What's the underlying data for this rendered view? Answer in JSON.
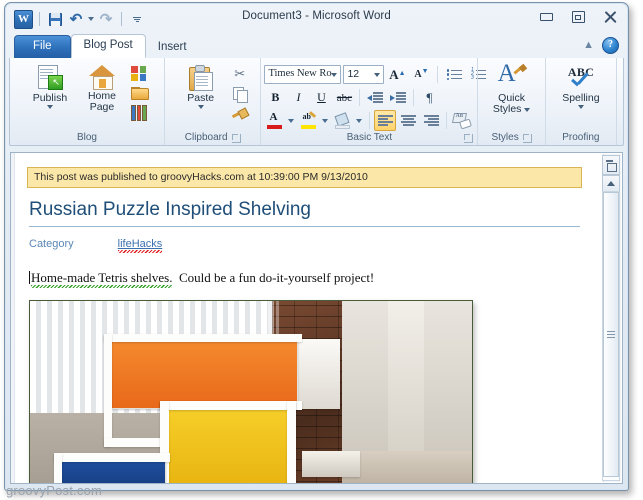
{
  "window": {
    "title": "Document3 - Microsoft Word",
    "app_logo": "word-logo",
    "logo_letter": "W",
    "quick_access": [
      {
        "name": "save-button",
        "icon": "save-icon",
        "label": "Save"
      },
      {
        "name": "undo-button",
        "icon": "undo-icon",
        "label": "Undo"
      },
      {
        "name": "redo-button",
        "icon": "redo-icon",
        "label": "Redo"
      },
      {
        "name": "customize-qat-button",
        "icon": "chevron-down-icon",
        "label": "Customize Quick Access Toolbar"
      }
    ],
    "controls": [
      {
        "name": "minimize-button",
        "icon": "minimize-icon",
        "label": "Minimize"
      },
      {
        "name": "restore-button",
        "icon": "restore-icon",
        "label": "Restore Down"
      },
      {
        "name": "close-button",
        "icon": "close-icon",
        "label": "Close"
      }
    ]
  },
  "tabs": [
    {
      "label": "File",
      "state": "file"
    },
    {
      "label": "Blog Post",
      "state": "active"
    },
    {
      "label": "Insert",
      "state": "normal"
    }
  ],
  "tab_right": {
    "collapse_label": "Minimize the Ribbon",
    "help_label": "?"
  },
  "ribbon": {
    "groups": [
      {
        "label": "Blog",
        "has_launcher": false,
        "big_buttons": [
          {
            "name": "publish-button",
            "icon": "publish-icon",
            "line1": "Publish",
            "line2": "",
            "has_arrow": true
          },
          {
            "name": "home-page-button",
            "icon": "home-icon",
            "line1": "Home",
            "line2": "Page",
            "has_arrow": false
          }
        ],
        "small_buttons": [
          {
            "name": "insert-category-button",
            "icon": "category-grid-icon",
            "label": "Insert Category"
          },
          {
            "name": "open-existing-button",
            "icon": "folder-icon",
            "label": "Open Existing"
          },
          {
            "name": "manage-accounts-button",
            "icon": "accounts-icon",
            "label": "Manage Accounts"
          }
        ]
      },
      {
        "label": "Clipboard",
        "has_launcher": true,
        "big_buttons": [
          {
            "name": "paste-button",
            "icon": "paste-icon",
            "line1": "Paste",
            "line2": "",
            "has_arrow": true
          }
        ],
        "small_buttons": [
          {
            "name": "cut-button",
            "icon": "scissors-icon",
            "label": "Cut"
          },
          {
            "name": "copy-button",
            "icon": "copy-icon",
            "label": "Copy"
          },
          {
            "name": "format-painter-button",
            "icon": "format-painter-icon",
            "label": "Format Painter"
          }
        ]
      },
      {
        "label": "Basic Text",
        "has_launcher": true,
        "font_name": "Times New Ro",
        "font_size": "12",
        "row1": [
          {
            "name": "grow-font-button",
            "icon": "grow-font-icon",
            "label": "Grow Font"
          },
          {
            "name": "shrink-font-button",
            "icon": "shrink-font-icon",
            "label": "Shrink Font"
          },
          {
            "name": "bullets-button",
            "icon": "bullets-icon",
            "label": "Bullets"
          },
          {
            "name": "numbering-button",
            "icon": "numbering-icon",
            "label": "Numbering"
          }
        ],
        "row2": [
          {
            "name": "bold-button",
            "icon": "bold-icon",
            "label": "B"
          },
          {
            "name": "italic-button",
            "icon": "italic-icon",
            "label": "I"
          },
          {
            "name": "underline-button",
            "icon": "underline-icon",
            "label": "U"
          },
          {
            "name": "strikethrough-button",
            "icon": "strikethrough-icon",
            "label": "abc"
          },
          {
            "name": "decrease-indent-button",
            "icon": "decrease-indent-icon",
            "label": "Decrease Indent"
          },
          {
            "name": "increase-indent-button",
            "icon": "increase-indent-icon",
            "label": "Increase Indent"
          },
          {
            "name": "show-formatting-marks-button",
            "icon": "pilcrow-icon",
            "label": "¶"
          }
        ],
        "row3": [
          {
            "name": "font-color-button",
            "icon": "font-color-icon",
            "label": "Font Color"
          },
          {
            "name": "text-highlight-button",
            "icon": "highlight-icon",
            "label": "Text Highlight Color"
          },
          {
            "name": "shading-button",
            "icon": "shading-icon",
            "label": "Shading"
          },
          {
            "name": "align-left-button",
            "icon": "align-left-icon",
            "label": "Align Left",
            "active": true
          },
          {
            "name": "align-center-button",
            "icon": "align-center-icon",
            "label": "Center",
            "active": false
          },
          {
            "name": "align-right-button",
            "icon": "align-right-icon",
            "label": "Align Right",
            "active": false
          },
          {
            "name": "clear-formatting-button",
            "icon": "clear-formatting-icon",
            "label": "Clear Formatting"
          }
        ]
      },
      {
        "label": "Styles",
        "has_launcher": true,
        "big_buttons": [
          {
            "name": "quick-styles-button",
            "icon": "quick-styles-icon",
            "line1": "Quick",
            "line2": "Styles",
            "has_arrow": true
          }
        ]
      },
      {
        "label": "Proofing",
        "has_launcher": false,
        "big_buttons": [
          {
            "name": "spelling-button",
            "icon": "spelling-icon",
            "line1": "Spelling",
            "line2": "",
            "has_arrow": true
          }
        ]
      }
    ]
  },
  "document": {
    "notice": "This post was published to groovyHacks.com at 10:39:00 PM 9/13/2010",
    "post_title": "Russian Puzzle Inspired Shelving",
    "category_label": "Category",
    "category_value": "lifeHacks",
    "body_part1": "Home-made Tetris shelves.",
    "body_part2": "Could be a fun do-it-yourself project!",
    "image_alt": "tetris-shelving-photo"
  },
  "scrollbar": {
    "ruler_toggle_label": "View Ruler",
    "scroll_up_label": "Scroll Up"
  },
  "watermark": "groovyPost.com",
  "colors": {
    "accent_blue": "#2f72bd",
    "notice_bg": "#fbe7a8",
    "title_blue": "#1f4e79",
    "link_blue": "#3a6fb0"
  }
}
